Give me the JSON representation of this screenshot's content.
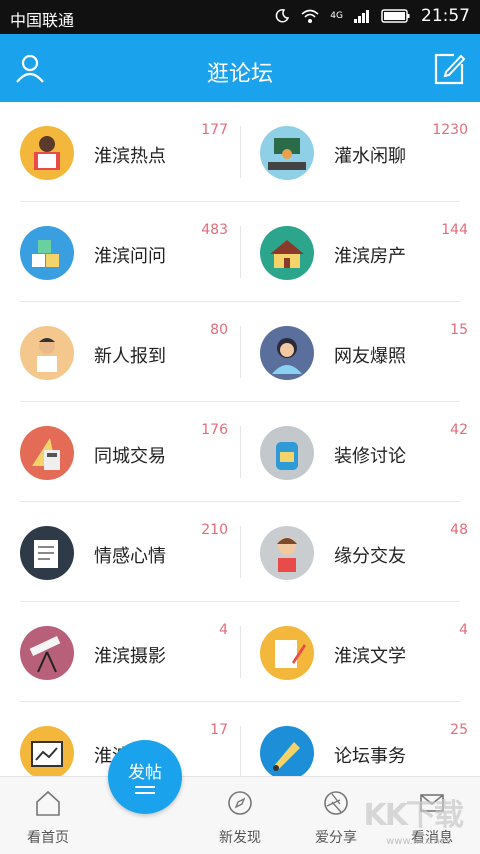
{
  "status_bar": {
    "carrier": "中国联通",
    "network": "4G",
    "time": "21:57"
  },
  "header": {
    "title": "逛论坛"
  },
  "forums": [
    {
      "label": "淮滨热点",
      "count": "177",
      "icon": "reader-icon",
      "bg": "#f2b73b"
    },
    {
      "label": "灌水闲聊",
      "count": "1230",
      "icon": "teacher-icon",
      "bg": "#8fd0e6"
    },
    {
      "label": "淮滨问问",
      "count": "483",
      "icon": "blocks-icon",
      "bg": "#3a9fe0"
    },
    {
      "label": "淮滨房产",
      "count": "144",
      "icon": "house-icon",
      "bg": "#2ca58d"
    },
    {
      "label": "新人报到",
      "count": "80",
      "icon": "newcomer-icon",
      "bg": "#f4c78c"
    },
    {
      "label": "网友爆照",
      "count": "15",
      "icon": "photo-user-icon",
      "bg": "#5b6f9c"
    },
    {
      "label": "同城交易",
      "count": "176",
      "icon": "calculator-icon",
      "bg": "#e46b55"
    },
    {
      "label": "装修讨论",
      "count": "42",
      "icon": "backpack-icon",
      "bg": "#c3c8cc"
    },
    {
      "label": "情感心情",
      "count": "210",
      "icon": "notepad-icon",
      "bg": "#2e3a48"
    },
    {
      "label": "缘分交友",
      "count": "48",
      "icon": "girl-icon",
      "bg": "#c9cdd0"
    },
    {
      "label": "淮滨摄影",
      "count": "4",
      "icon": "telescope-icon",
      "bg": "#b8607a"
    },
    {
      "label": "淮滨文学",
      "count": "4",
      "icon": "pen-paper-icon",
      "bg": "#f2b73b"
    },
    {
      "label": "淮滨商讯",
      "count": "17",
      "icon": "chart-board-icon",
      "bg": "#f2b73b"
    },
    {
      "label": "论坛事务",
      "count": "25",
      "icon": "fountain-pen-icon",
      "bg": "#1d8fd8"
    }
  ],
  "tabs": {
    "home": "看首页",
    "discover": "新发现",
    "share": "爱分享",
    "messages": "看消息",
    "post": "发帖"
  },
  "watermark": {
    "text": "KK下载",
    "url": "www.kkx.net"
  },
  "colors": {
    "accent": "#1aa3ec",
    "count": "#e36d7a"
  }
}
